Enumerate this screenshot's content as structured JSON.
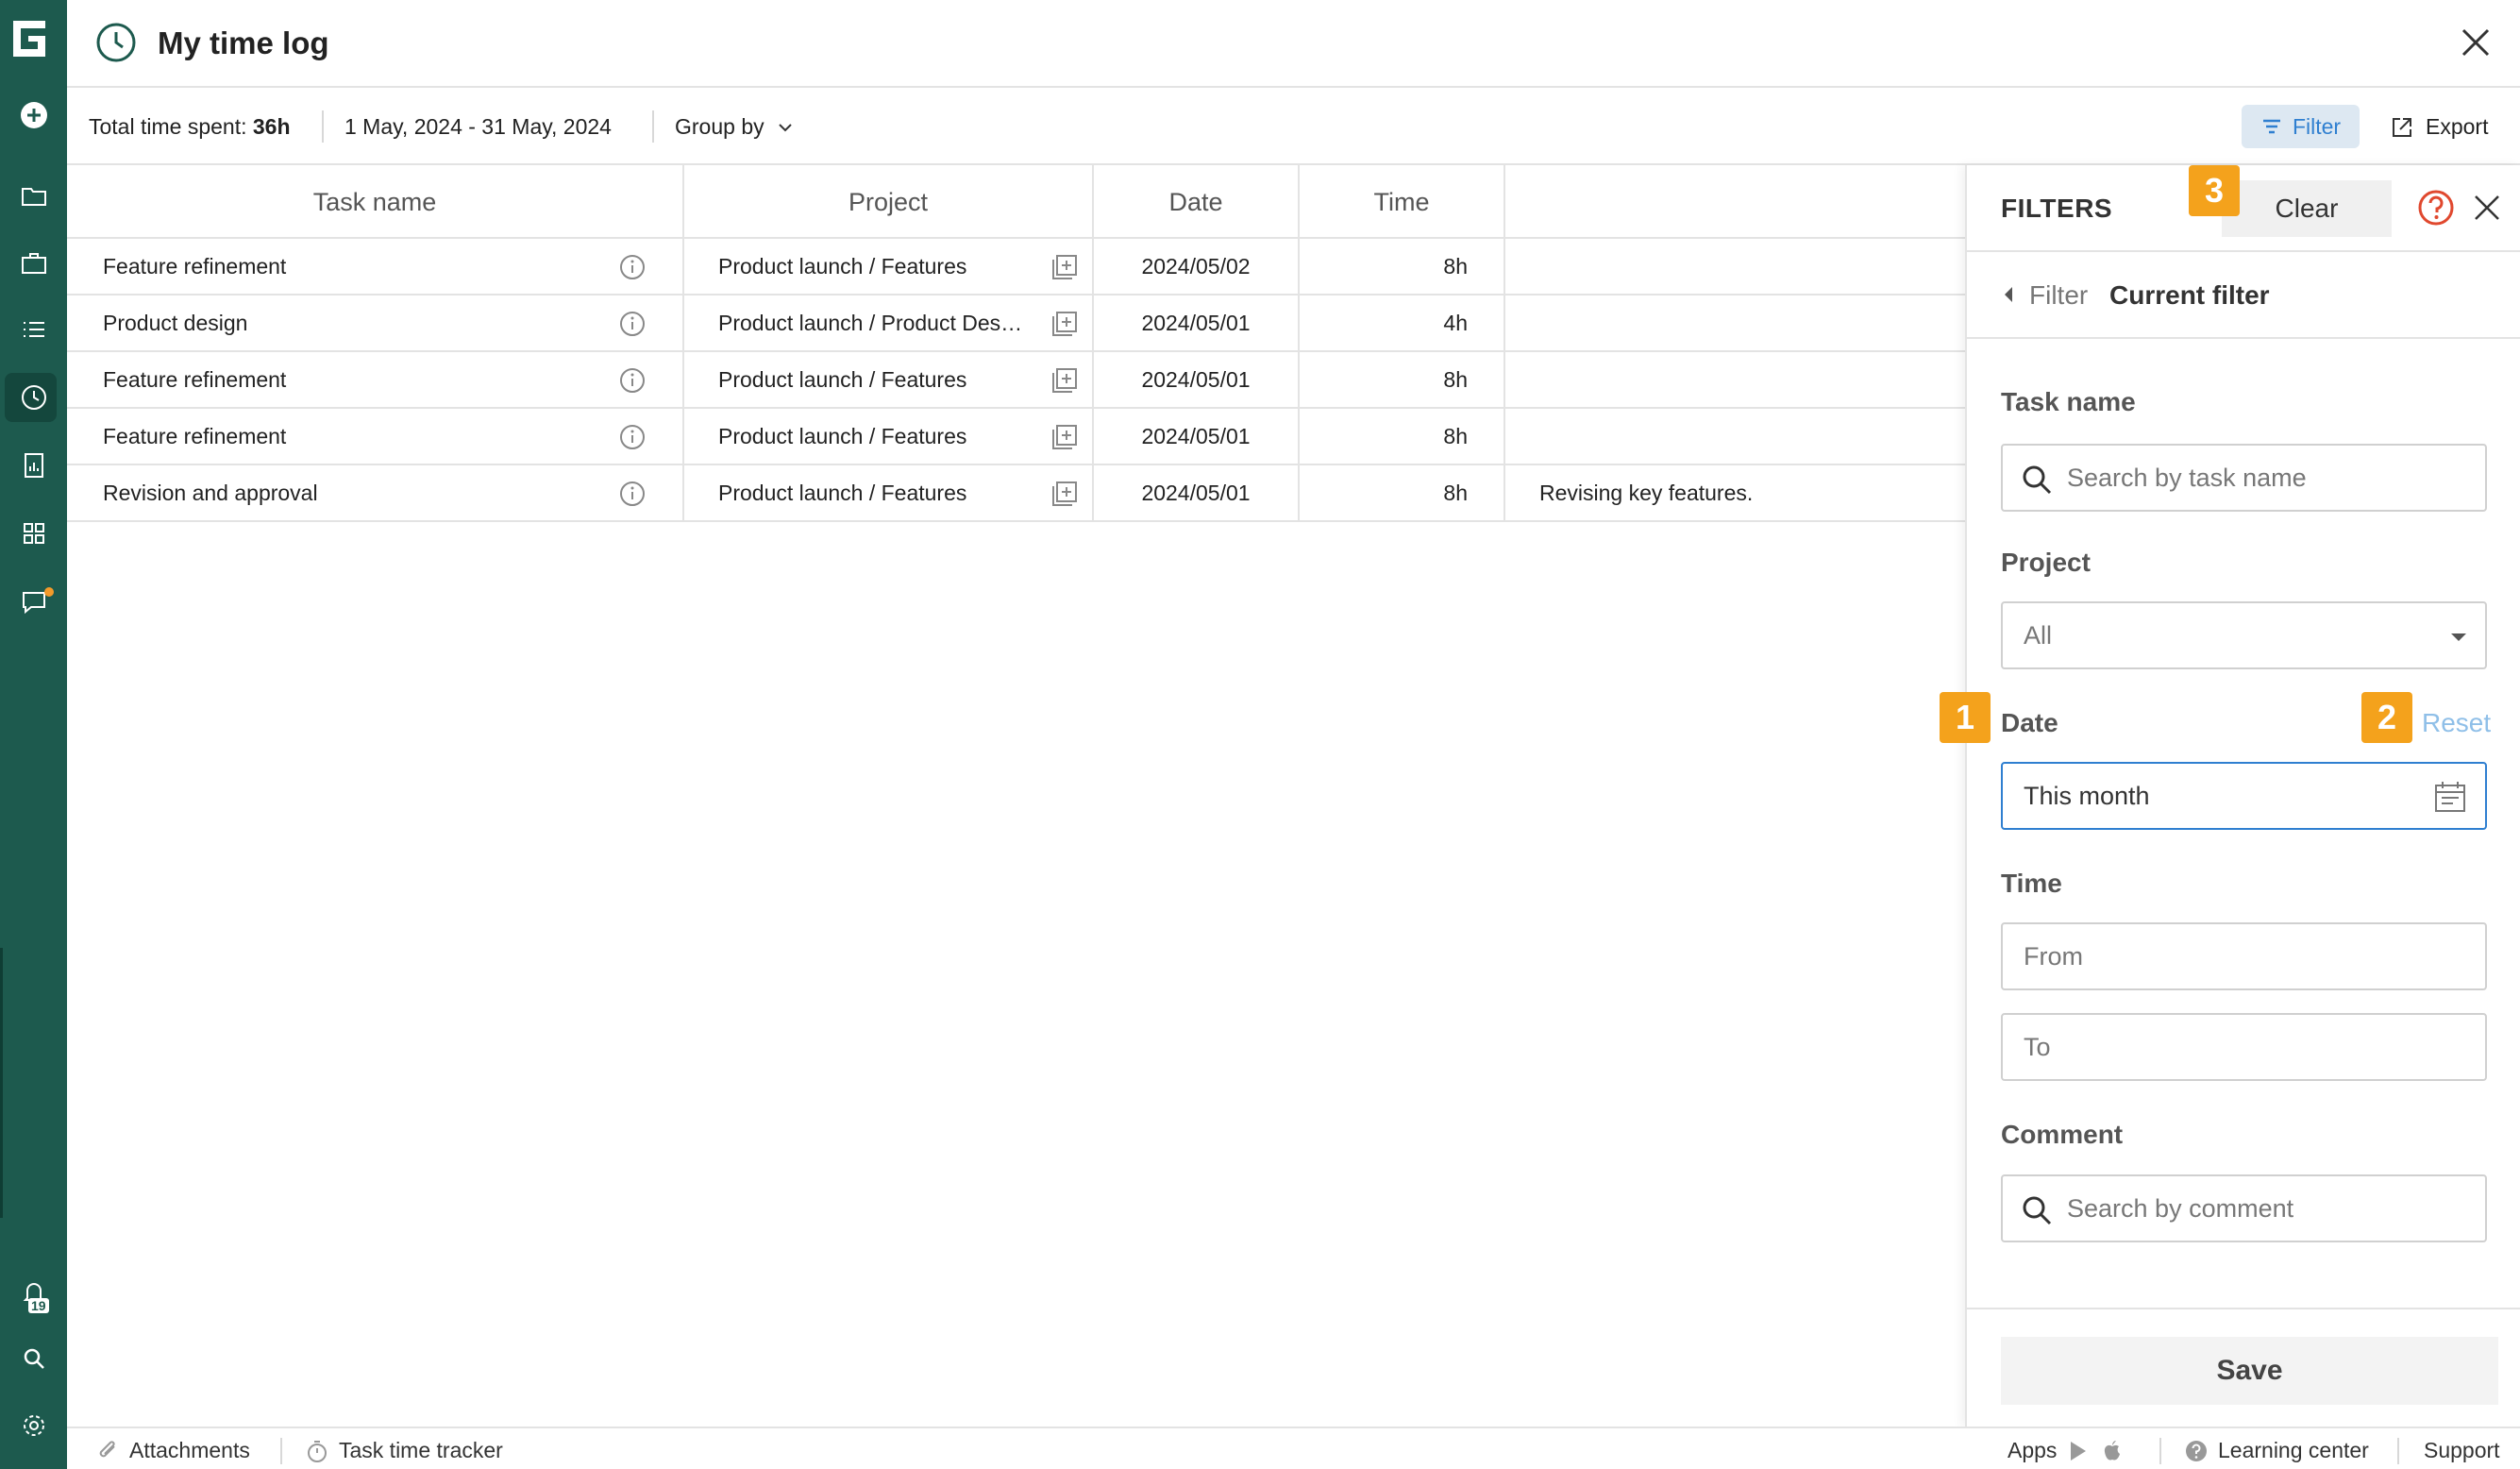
{
  "window": {
    "title": "My time log"
  },
  "toolbar": {
    "total_label": "Total time spent:",
    "total_value": "36h",
    "date_range": "1 May, 2024 - 31 May, 2024",
    "group_by": "Group by",
    "filter": "Filter",
    "export": "Export"
  },
  "table": {
    "headers": [
      "Task name",
      "Project",
      "Date",
      "Time"
    ],
    "rows": [
      {
        "task": "Feature refinement",
        "project": "Product launch / Features",
        "date": "2024/05/02",
        "time": "8h",
        "comment": ""
      },
      {
        "task": "Product design",
        "project": "Product launch / Product Design",
        "date": "2024/05/01",
        "time": "4h",
        "comment": ""
      },
      {
        "task": "Feature refinement",
        "project": "Product launch / Features",
        "date": "2024/05/01",
        "time": "8h",
        "comment": ""
      },
      {
        "task": "Feature refinement",
        "project": "Product launch / Features",
        "date": "2024/05/01",
        "time": "8h",
        "comment": ""
      },
      {
        "task": "Revision and approval",
        "project": "Product launch / Features",
        "date": "2024/05/01",
        "time": "8h",
        "comment": "Revising key features."
      }
    ]
  },
  "filters": {
    "title": "FILTERS",
    "clear": "Clear",
    "breadcrumb_parent": "Filter",
    "breadcrumb_current": "Current filter",
    "task_name_label": "Task name",
    "task_name_placeholder": "Search by task name",
    "project_label": "Project",
    "project_value": "All",
    "date_label": "Date",
    "date_reset": "Reset",
    "date_value": "This month",
    "time_label": "Time",
    "time_from_placeholder": "From",
    "time_to_placeholder": "To",
    "comment_label": "Comment",
    "comment_placeholder": "Search by comment",
    "save": "Save"
  },
  "annotations": {
    "badge1": "1",
    "badge2": "2",
    "badge3": "3"
  },
  "sidebar": {
    "notification_count": "19"
  },
  "bottombar": {
    "attachments": "Attachments",
    "task_time_tracker": "Task time tracker",
    "apps": "Apps",
    "learning_center": "Learning center",
    "support": "Support"
  },
  "colors": {
    "sidebar": "#1d5a4e",
    "accent": "#2f7fd0",
    "badge": "#f4a21c"
  }
}
